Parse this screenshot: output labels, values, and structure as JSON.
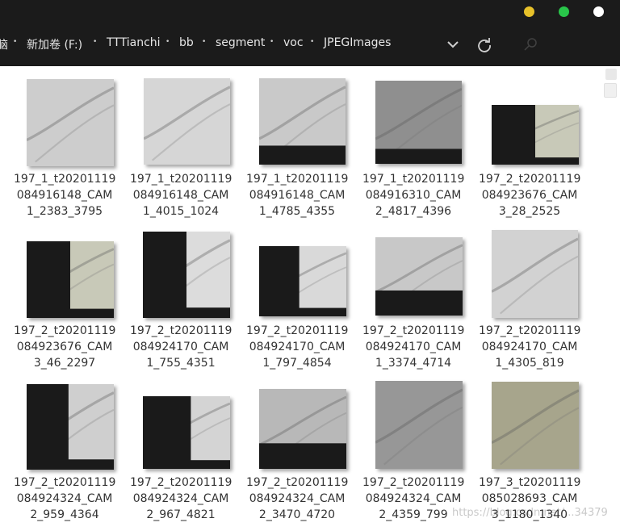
{
  "window": {
    "controls": [
      {
        "name": "minimize",
        "color": "#e7c12a"
      },
      {
        "name": "maximize",
        "color": "#29c64a"
      },
      {
        "name": "close",
        "color": "#ffffff"
      }
    ]
  },
  "breadcrumb": {
    "items": [
      "脑",
      "新加卷 (F:)",
      "TTTianchi",
      "bb",
      "segment",
      "voc",
      "JPEGImages"
    ],
    "separator": "•"
  },
  "files": [
    {
      "line1": "197_1_t20201119",
      "line2": "084916148_CAM",
      "line3": "1_2383_3795"
    },
    {
      "line1": "197_1_t20201119",
      "line2": "084916148_CAM",
      "line3": "1_4015_1024"
    },
    {
      "line1": "197_1_t20201119",
      "line2": "084916148_CAM",
      "line3": "1_4785_4355"
    },
    {
      "line1": "197_1_t20201119",
      "line2": "084916310_CAM",
      "line3": "2_4817_4396"
    },
    {
      "line1": "197_2_t20201119",
      "line2": "084923676_CAM",
      "line3": "3_28_2525"
    },
    {
      "line1": "197_2_t20201119",
      "line2": "084923676_CAM",
      "line3": "3_46_2297"
    },
    {
      "line1": "197_2_t20201119",
      "line2": "084924170_CAM",
      "line3": "1_755_4351"
    },
    {
      "line1": "197_2_t20201119",
      "line2": "084924170_CAM",
      "line3": "1_797_4854"
    },
    {
      "line1": "197_2_t20201119",
      "line2": "084924170_CAM",
      "line3": "1_3374_4714"
    },
    {
      "line1": "197_2_t20201119",
      "line2": "084924170_CAM",
      "line3": "1_4305_819"
    },
    {
      "line1": "197_2_t20201119",
      "line2": "084924324_CAM",
      "line3": "2_959_4364"
    },
    {
      "line1": "197_2_t20201119",
      "line2": "084924324_CAM",
      "line3": "2_967_4821"
    },
    {
      "line1": "197_2_t20201119",
      "line2": "084924324_CAM",
      "line3": "2_3470_4720"
    },
    {
      "line1": "197_2_t20201119",
      "line2": "084924324_CAM",
      "line3": "2_4359_799"
    },
    {
      "line1": "197_3_t20201119",
      "line2": "085028693_CAM",
      "line3": "3_1180_1340"
    }
  ],
  "watermark": "https://blog.csdn.net/...34379"
}
